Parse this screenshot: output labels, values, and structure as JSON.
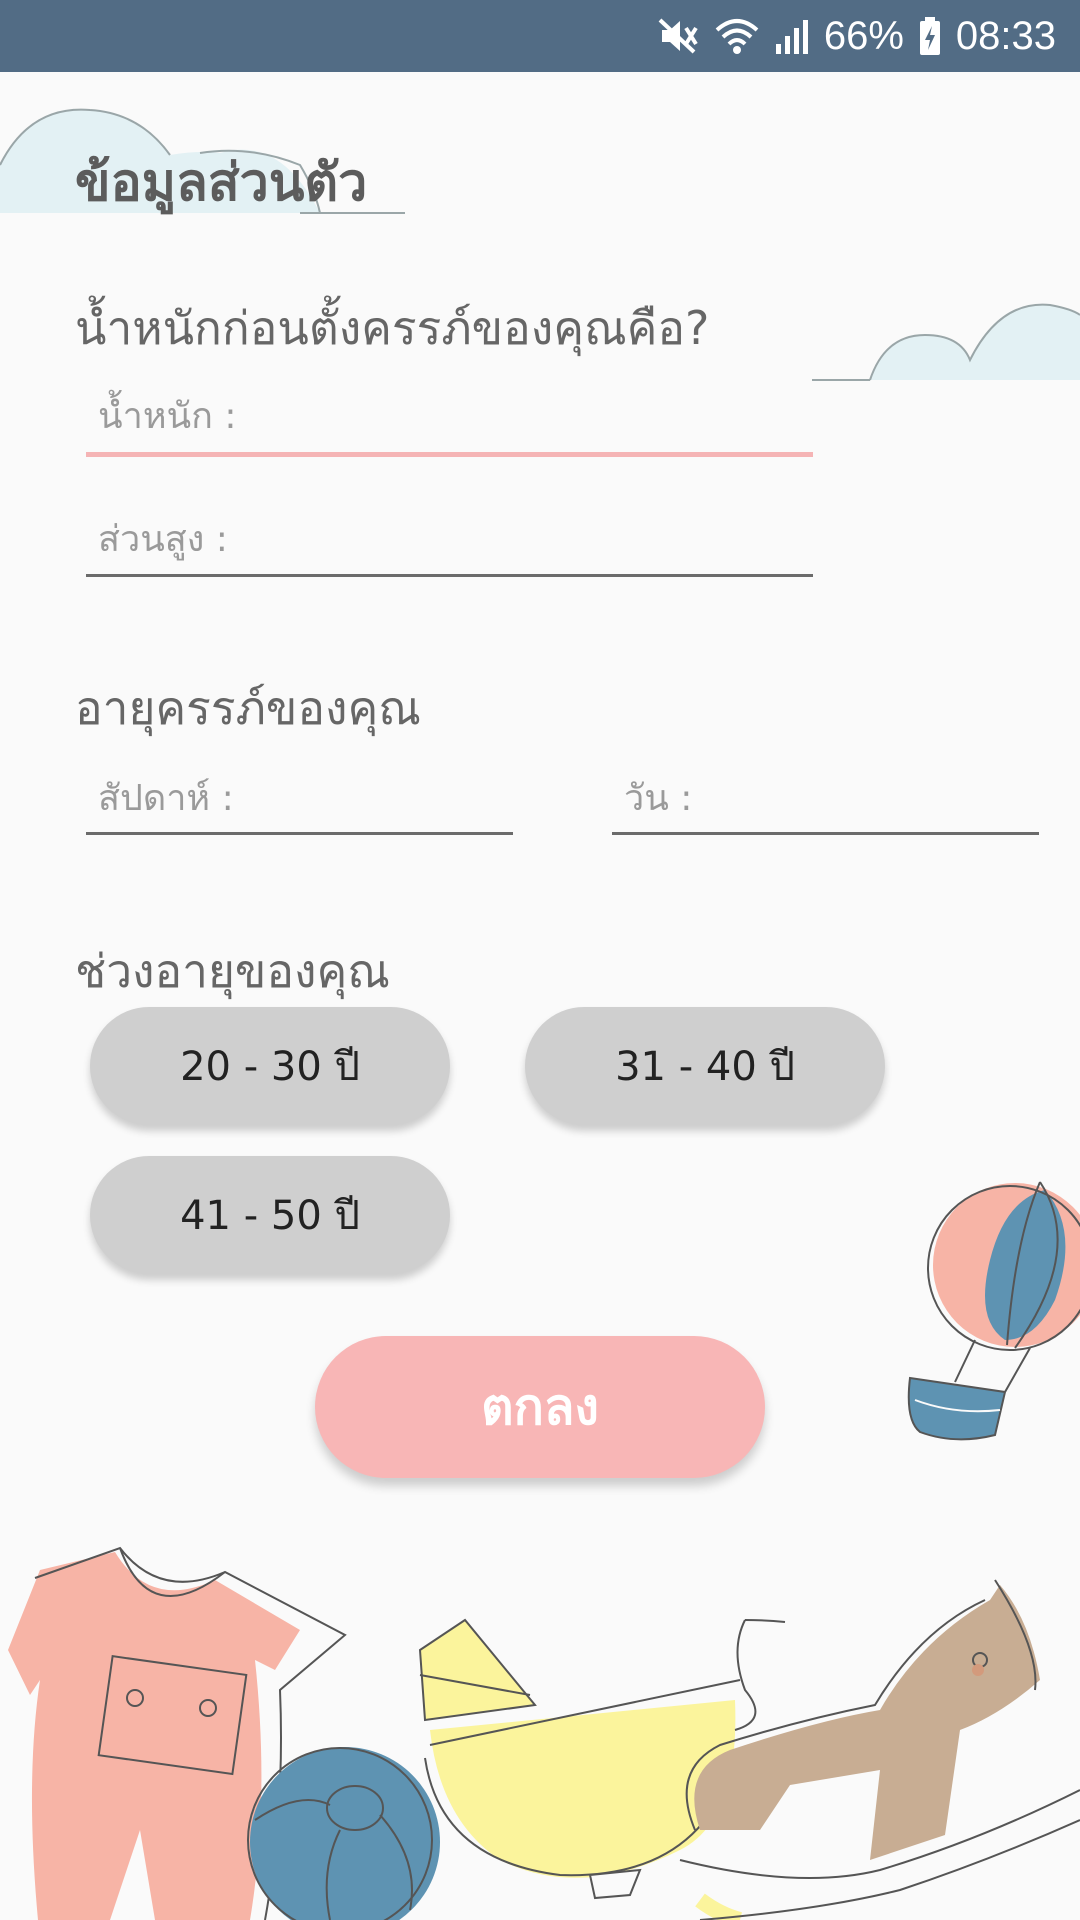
{
  "status_bar": {
    "battery": "66%",
    "time": "08:33"
  },
  "page": {
    "title": "ข้อมูลส่วนตัว"
  },
  "weight_section": {
    "heading": "น้ำหนักก่อนตั้งครรภ์ของคุณคือ?",
    "weight_placeholder": "น้ำหนัก :",
    "height_placeholder": "ส่วนสูง :"
  },
  "pregnancy_section": {
    "heading": "อายุครรภ์ของคุณ",
    "weeks_placeholder": "สัปดาห์ :",
    "days_placeholder": "วัน :"
  },
  "age_section": {
    "heading": "ช่วงอายุของคุณ",
    "options": [
      "20 - 30 ปี",
      "31 - 40 ปี",
      "41 - 50 ปี"
    ]
  },
  "submit_label": "ตกลง",
  "colors": {
    "status_bar": "#526c85",
    "accent_pink": "#f8b6b6",
    "pill_gray": "#cfcfcf",
    "cloud": "#e3f1f4",
    "balloon_blue": "#5e93b2",
    "toy_yellow": "#fbf49c",
    "horse_tan": "#c8ad93"
  },
  "icons": [
    "mute-icon",
    "wifi-icon",
    "signal-icon",
    "battery-charging-icon"
  ]
}
